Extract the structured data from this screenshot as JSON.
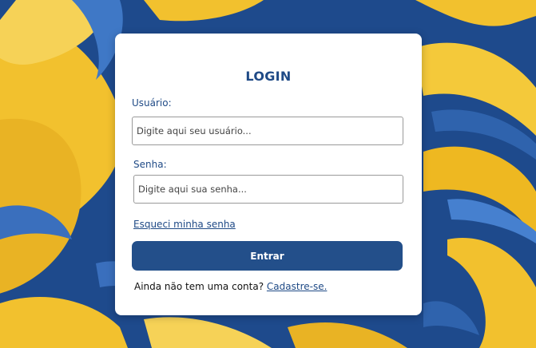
{
  "colors": {
    "primary": "#234f8a",
    "label": "#1f4a86",
    "background_blue": "#1f4c8f",
    "background_yellow": "#f2c12e"
  },
  "login": {
    "title": "LOGIN",
    "username_label": "Usuário:",
    "username_placeholder": "Digite aqui seu usuário...",
    "password_label": "Senha:",
    "password_placeholder": "Digite aqui sua senha...",
    "forgot_link": "Esqueci minha senha",
    "submit_label": "Entrar",
    "signup_prompt": "Ainda não tem uma conta?",
    "signup_link": "Cadastre-se."
  }
}
